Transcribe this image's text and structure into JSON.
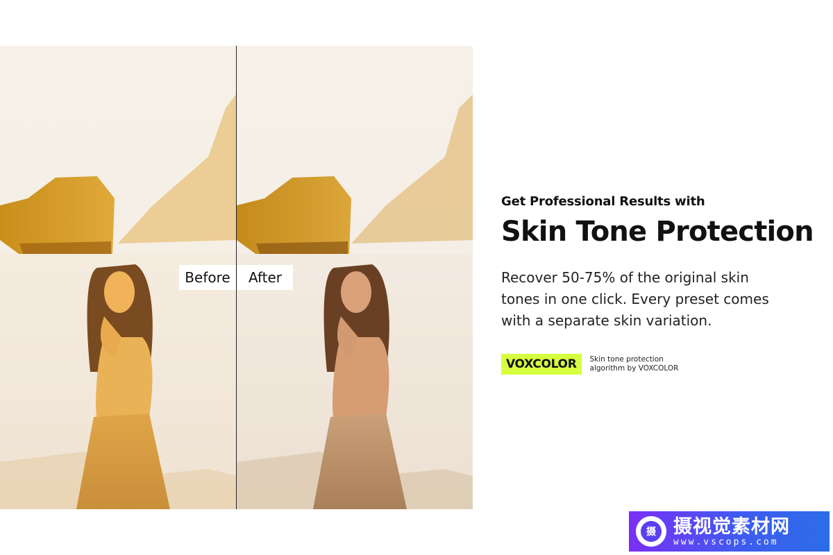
{
  "comparison": {
    "before_label": "Before",
    "after_label": "After"
  },
  "content": {
    "eyebrow": "Get Professional Results with",
    "headline": "Skin Tone Protection",
    "body_lines": [
      "Recover 50-75% of the original skin",
      "tones in one click.  Every preset comes",
      "with a separate skin variation."
    ]
  },
  "brand": {
    "badge": "VOXCOLOR",
    "note_lines": [
      "Skin tone protection",
      "algorithm by VOXCOLOR"
    ],
    "badge_color": "#d6ff3f"
  },
  "watermark": {
    "logo_char": "摄",
    "title": "摄视觉素材网",
    "url": "www.vscops.com"
  },
  "icons": [
    "photo-before",
    "photo-after",
    "watermark-logo-icon"
  ]
}
